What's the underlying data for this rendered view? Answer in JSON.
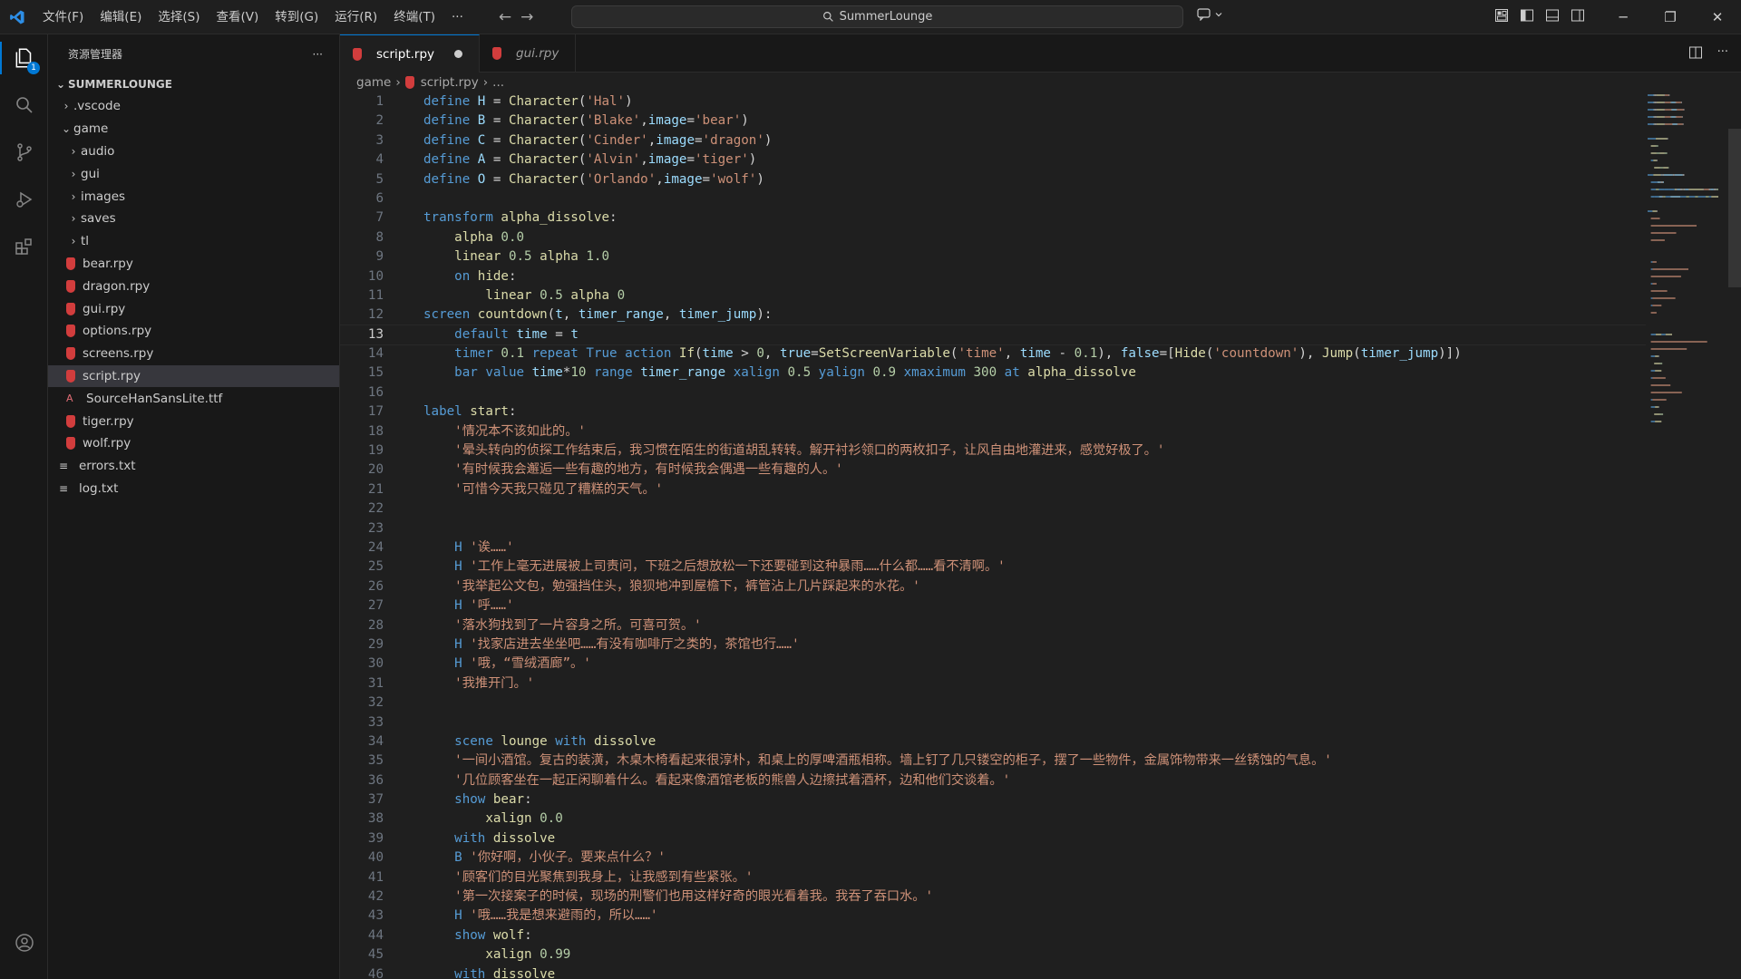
{
  "window": {
    "search_text": "SummerLounge",
    "menu": [
      "文件(F)",
      "编辑(E)",
      "选择(S)",
      "查看(V)",
      "转到(G)",
      "运行(R)",
      "终端(T)",
      "···"
    ]
  },
  "activity": {
    "explorer_badge": "1"
  },
  "sidebar": {
    "title": "资源管理器",
    "more": "···",
    "root": "SUMMERLOUNGE",
    "tree": [
      {
        "label": ".vscode",
        "depth": 0,
        "kind": "folder-closed"
      },
      {
        "label": "game",
        "depth": 0,
        "kind": "folder-open"
      },
      {
        "label": "audio",
        "depth": 1,
        "kind": "folder-closed"
      },
      {
        "label": "gui",
        "depth": 1,
        "kind": "folder-closed"
      },
      {
        "label": "images",
        "depth": 1,
        "kind": "folder-closed"
      },
      {
        "label": "saves",
        "depth": 1,
        "kind": "folder-closed"
      },
      {
        "label": "tl",
        "depth": 1,
        "kind": "folder-closed"
      },
      {
        "label": "bear.rpy",
        "depth": 1,
        "kind": "rpy"
      },
      {
        "label": "dragon.rpy",
        "depth": 1,
        "kind": "rpy"
      },
      {
        "label": "gui.rpy",
        "depth": 1,
        "kind": "rpy"
      },
      {
        "label": "options.rpy",
        "depth": 1,
        "kind": "rpy"
      },
      {
        "label": "screens.rpy",
        "depth": 1,
        "kind": "rpy"
      },
      {
        "label": "script.rpy",
        "depth": 1,
        "kind": "rpy",
        "selected": true
      },
      {
        "label": "SourceHanSansLite.ttf",
        "depth": 1,
        "kind": "ttf"
      },
      {
        "label": "tiger.rpy",
        "depth": 1,
        "kind": "rpy"
      },
      {
        "label": "wolf.rpy",
        "depth": 1,
        "kind": "rpy"
      },
      {
        "label": "errors.txt",
        "depth": 0,
        "kind": "txt"
      },
      {
        "label": "log.txt",
        "depth": 0,
        "kind": "txt"
      }
    ]
  },
  "editor": {
    "tabs": [
      {
        "label": "script.rpy",
        "active": true,
        "dirty": true
      },
      {
        "label": "gui.rpy",
        "active": false,
        "preview": true
      }
    ],
    "breadcrumbs": [
      "game",
      "script.rpy",
      "..."
    ],
    "current_line": 13,
    "lines": [
      [
        [
          "kw",
          "define "
        ],
        [
          "var",
          "H"
        ],
        [
          "txt2",
          " = "
        ],
        [
          "fn",
          "Character"
        ],
        [
          "txt2",
          "("
        ],
        [
          "str",
          "'Hal'"
        ],
        [
          "txt2",
          ")"
        ]
      ],
      [
        [
          "kw",
          "define "
        ],
        [
          "var",
          "B"
        ],
        [
          "txt2",
          " = "
        ],
        [
          "fn",
          "Character"
        ],
        [
          "txt2",
          "("
        ],
        [
          "str",
          "'Blake'"
        ],
        [
          "txt2",
          ","
        ],
        [
          "var",
          "image"
        ],
        [
          "txt2",
          "="
        ],
        [
          "str",
          "'bear'"
        ],
        [
          "txt2",
          ")"
        ]
      ],
      [
        [
          "kw",
          "define "
        ],
        [
          "var",
          "C"
        ],
        [
          "txt2",
          " = "
        ],
        [
          "fn",
          "Character"
        ],
        [
          "txt2",
          "("
        ],
        [
          "str",
          "'Cinder'"
        ],
        [
          "txt2",
          ","
        ],
        [
          "var",
          "image"
        ],
        [
          "txt2",
          "="
        ],
        [
          "str",
          "'dragon'"
        ],
        [
          "txt2",
          ")"
        ]
      ],
      [
        [
          "kw",
          "define "
        ],
        [
          "var",
          "A"
        ],
        [
          "txt2",
          " = "
        ],
        [
          "fn",
          "Character"
        ],
        [
          "txt2",
          "("
        ],
        [
          "str",
          "'Alvin'"
        ],
        [
          "txt2",
          ","
        ],
        [
          "var",
          "image"
        ],
        [
          "txt2",
          "="
        ],
        [
          "str",
          "'tiger'"
        ],
        [
          "txt2",
          ")"
        ]
      ],
      [
        [
          "kw",
          "define "
        ],
        [
          "var",
          "O"
        ],
        [
          "txt2",
          " = "
        ],
        [
          "fn",
          "Character"
        ],
        [
          "txt2",
          "("
        ],
        [
          "str",
          "'Orlando'"
        ],
        [
          "txt2",
          ","
        ],
        [
          "var",
          "image"
        ],
        [
          "txt2",
          "="
        ],
        [
          "str",
          "'wolf'"
        ],
        [
          "txt2",
          ")"
        ]
      ],
      [],
      [
        [
          "kw",
          "transform "
        ],
        [
          "fn",
          "alpha_dissolve"
        ],
        [
          "txt2",
          ":"
        ]
      ],
      [
        [
          "txt2",
          "    "
        ],
        [
          "fn",
          "alpha "
        ],
        [
          "num",
          "0.0"
        ]
      ],
      [
        [
          "txt2",
          "    "
        ],
        [
          "fn",
          "linear "
        ],
        [
          "num",
          "0.5 "
        ],
        [
          "fn",
          "alpha "
        ],
        [
          "num",
          "1.0"
        ]
      ],
      [
        [
          "txt2",
          "    "
        ],
        [
          "kw",
          "on "
        ],
        [
          "fn",
          "hide"
        ],
        [
          "txt2",
          ":"
        ]
      ],
      [
        [
          "txt2",
          "        "
        ],
        [
          "fn",
          "linear "
        ],
        [
          "num",
          "0.5 "
        ],
        [
          "fn",
          "alpha "
        ],
        [
          "num",
          "0"
        ]
      ],
      [
        [
          "kw",
          "screen "
        ],
        [
          "fn",
          "countdown"
        ],
        [
          "txt2",
          "("
        ],
        [
          "var",
          "t"
        ],
        [
          "txt2",
          ", "
        ],
        [
          "var",
          "timer_range"
        ],
        [
          "txt2",
          ", "
        ],
        [
          "var",
          "timer_jump"
        ],
        [
          "txt2",
          "):"
        ]
      ],
      [
        [
          "txt2",
          "    "
        ],
        [
          "kw",
          "default "
        ],
        [
          "var",
          "time"
        ],
        [
          "txt2",
          " = "
        ],
        [
          "var",
          "t"
        ]
      ],
      [
        [
          "txt2",
          "    "
        ],
        [
          "kw",
          "timer "
        ],
        [
          "num",
          "0.1 "
        ],
        [
          "kw",
          "repeat "
        ],
        [
          "kw",
          "True "
        ],
        [
          "kw",
          "action "
        ],
        [
          "fn",
          "If"
        ],
        [
          "txt2",
          "("
        ],
        [
          "var",
          "time"
        ],
        [
          "txt2",
          " > "
        ],
        [
          "num",
          "0"
        ],
        [
          "txt2",
          ", "
        ],
        [
          "var",
          "true"
        ],
        [
          "txt2",
          "="
        ],
        [
          "fn",
          "SetScreenVariable"
        ],
        [
          "txt2",
          "("
        ],
        [
          "str",
          "'time'"
        ],
        [
          "txt2",
          ", "
        ],
        [
          "var",
          "time"
        ],
        [
          "txt2",
          " - "
        ],
        [
          "num",
          "0.1"
        ],
        [
          "txt2",
          "), "
        ],
        [
          "var",
          "false"
        ],
        [
          "txt2",
          "=["
        ],
        [
          "fn",
          "Hide"
        ],
        [
          "txt2",
          "("
        ],
        [
          "str",
          "'countdown'"
        ],
        [
          "txt2",
          "), "
        ],
        [
          "fn",
          "Jump"
        ],
        [
          "txt2",
          "("
        ],
        [
          "var",
          "timer_jump"
        ],
        [
          "txt2",
          ")])"
        ]
      ],
      [
        [
          "txt2",
          "    "
        ],
        [
          "kw",
          "bar "
        ],
        [
          "kw",
          "value "
        ],
        [
          "var",
          "time"
        ],
        [
          "txt2",
          "*"
        ],
        [
          "num",
          "10 "
        ],
        [
          "kw",
          "range "
        ],
        [
          "var",
          "timer_range "
        ],
        [
          "kw",
          "xalign "
        ],
        [
          "num",
          "0.5 "
        ],
        [
          "kw",
          "yalign "
        ],
        [
          "num",
          "0.9 "
        ],
        [
          "kw",
          "xmaximum "
        ],
        [
          "num",
          "300 "
        ],
        [
          "kw",
          "at "
        ],
        [
          "fn",
          "alpha_dissolve"
        ]
      ],
      [],
      [
        [
          "kw",
          "label "
        ],
        [
          "fn",
          "start"
        ],
        [
          "txt2",
          ":"
        ]
      ],
      [
        [
          "txt2",
          "    "
        ],
        [
          "str",
          "'情况本不该如此的。'"
        ]
      ],
      [
        [
          "txt2",
          "    "
        ],
        [
          "str",
          "'晕头转向的侦探工作结束后，我习惯在陌生的街道胡乱转转。解开衬衫领口的两枚扣子，让风自由地灌进来，感觉好极了。'"
        ]
      ],
      [
        [
          "txt2",
          "    "
        ],
        [
          "str",
          "'有时候我会邂逅一些有趣的地方，有时候我会偶遇一些有趣的人。'"
        ]
      ],
      [
        [
          "txt2",
          "    "
        ],
        [
          "str",
          "'可惜今天我只碰见了糟糕的天气。'"
        ]
      ],
      [],
      [],
      [
        [
          "txt2",
          "    "
        ],
        [
          "kw",
          "H "
        ],
        [
          "str",
          "'诶……'"
        ]
      ],
      [
        [
          "txt2",
          "    "
        ],
        [
          "kw",
          "H "
        ],
        [
          "str",
          "'工作上毫无进展被上司责问，下班之后想放松一下还要碰到这种暴雨……什么都……看不清啊。'"
        ]
      ],
      [
        [
          "txt2",
          "    "
        ],
        [
          "str",
          "'我举起公文包，勉强挡住头，狼狈地冲到屋檐下，裤管沾上几片踩起来的水花。'"
        ]
      ],
      [
        [
          "txt2",
          "    "
        ],
        [
          "kw",
          "H "
        ],
        [
          "str",
          "'呼……'"
        ]
      ],
      [
        [
          "txt2",
          "    "
        ],
        [
          "str",
          "'落水狗找到了一片容身之所。可喜可贺。'"
        ]
      ],
      [
        [
          "txt2",
          "    "
        ],
        [
          "kw",
          "H "
        ],
        [
          "str",
          "'找家店进去坐坐吧……有没有咖啡厅之类的，茶馆也行……'"
        ]
      ],
      [
        [
          "txt2",
          "    "
        ],
        [
          "kw",
          "H "
        ],
        [
          "str",
          "'哦，“雪绒酒廊”。'"
        ]
      ],
      [
        [
          "txt2",
          "    "
        ],
        [
          "str",
          "'我推开门。'"
        ]
      ],
      [],
      [],
      [
        [
          "txt2",
          "    "
        ],
        [
          "kw",
          "scene "
        ],
        [
          "fn",
          "lounge "
        ],
        [
          "kw",
          "with "
        ],
        [
          "fn",
          "dissolve"
        ]
      ],
      [
        [
          "txt2",
          "    "
        ],
        [
          "str",
          "'一间小酒馆。复古的装潢，木桌木椅看起来很淳朴，和桌上的厚啤酒瓶相称。墙上钉了几只镂空的柜子，摆了一些物件，金属饰物带来一丝锈蚀的气息。'"
        ]
      ],
      [
        [
          "txt2",
          "    "
        ],
        [
          "str",
          "'几位顾客坐在一起正闲聊着什么。看起来像酒馆老板的熊兽人边擦拭着酒杯，边和他们交谈着。'"
        ]
      ],
      [
        [
          "txt2",
          "    "
        ],
        [
          "kw",
          "show "
        ],
        [
          "fn",
          "bear"
        ],
        [
          "txt2",
          ":"
        ]
      ],
      [
        [
          "txt2",
          "        "
        ],
        [
          "fn",
          "xalign "
        ],
        [
          "num",
          "0.0"
        ]
      ],
      [
        [
          "txt2",
          "    "
        ],
        [
          "kw",
          "with "
        ],
        [
          "fn",
          "dissolve"
        ]
      ],
      [
        [
          "txt2",
          "    "
        ],
        [
          "kw",
          "B "
        ],
        [
          "str",
          "'你好啊，小伙子。要来点什么？'"
        ]
      ],
      [
        [
          "txt2",
          "    "
        ],
        [
          "str",
          "'顾客们的目光聚焦到我身上，让我感到有些紧张。'"
        ]
      ],
      [
        [
          "txt2",
          "    "
        ],
        [
          "str",
          "'第一次接案子的时候，现场的刑警们也用这样好奇的眼光看着我。我吞了吞口水。'"
        ]
      ],
      [
        [
          "txt2",
          "    "
        ],
        [
          "kw",
          "H "
        ],
        [
          "str",
          "'哦……我是想来避雨的，所以……'"
        ]
      ],
      [
        [
          "txt2",
          "    "
        ],
        [
          "kw",
          "show "
        ],
        [
          "fn",
          "wolf"
        ],
        [
          "txt2",
          ":"
        ]
      ],
      [
        [
          "txt2",
          "        "
        ],
        [
          "fn",
          "xalign "
        ],
        [
          "num",
          "0.99"
        ]
      ],
      [
        [
          "txt2",
          "    "
        ],
        [
          "kw",
          "with "
        ],
        [
          "fn",
          "dissolve"
        ]
      ]
    ]
  }
}
